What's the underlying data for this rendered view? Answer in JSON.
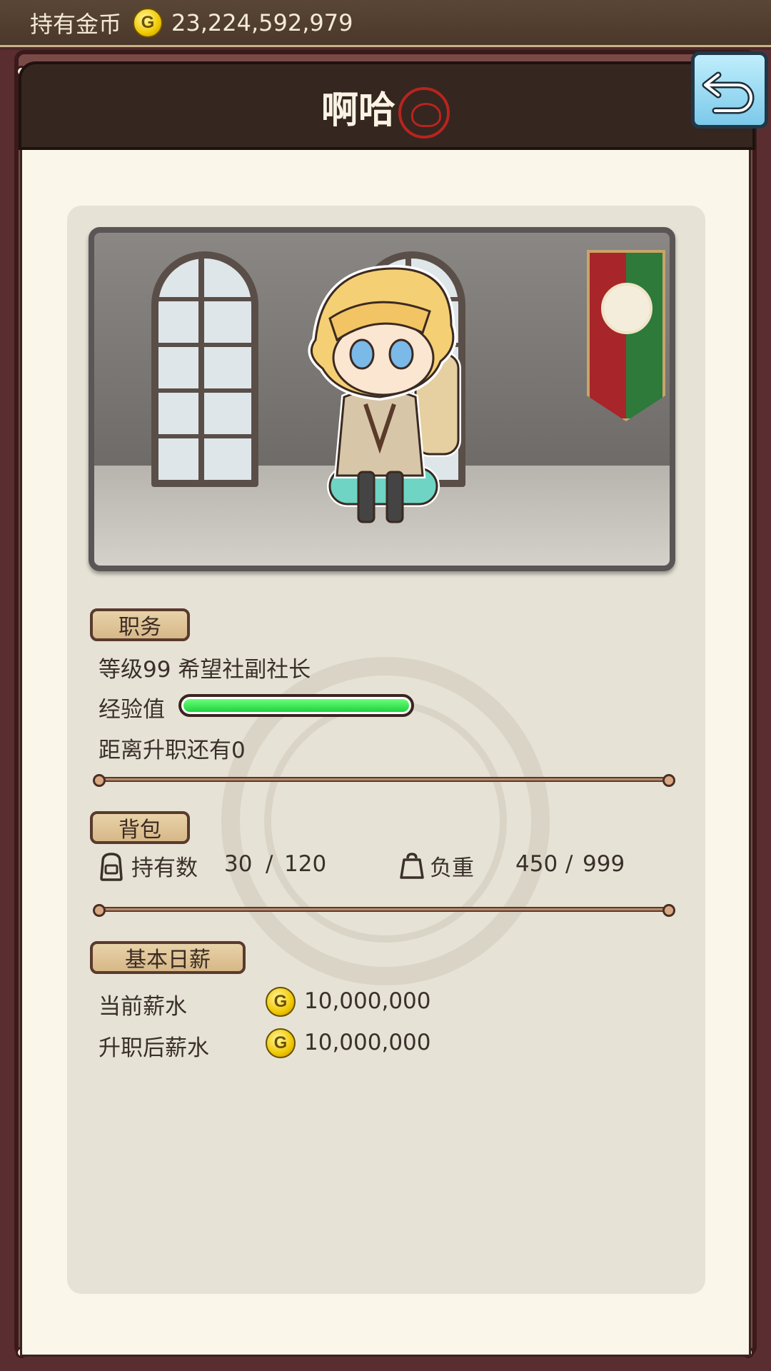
{
  "topbar": {
    "label": "持有金币",
    "coin_glyph": "G",
    "gold_amount": "23,224,592,979"
  },
  "header": {
    "title": "啊哈"
  },
  "portrait": {
    "scene": "guild-hall"
  },
  "job": {
    "tag": "职务",
    "level_title": "等级99 希望社副社长",
    "xp_label": "经验值",
    "xp_progress": 1.0,
    "promotion_text": "距离升职还有0"
  },
  "bag": {
    "tag": "背包",
    "count_label": "持有数",
    "count_current": "30",
    "count_sep": "/",
    "count_max": "120",
    "weight_label": "负重",
    "weight_current": "450",
    "weight_sep": "/",
    "weight_max": "999"
  },
  "salary": {
    "tag": "基本日薪",
    "current_label": "当前薪水",
    "current_value": "10,000,000",
    "after_label": "升职后薪水",
    "after_value": "10,000,000",
    "coin_glyph": "G"
  },
  "colors": {
    "xp_fill": "#1fd23c",
    "accent_brown": "#5a3a2e",
    "back_button": "#7cc9ea"
  }
}
